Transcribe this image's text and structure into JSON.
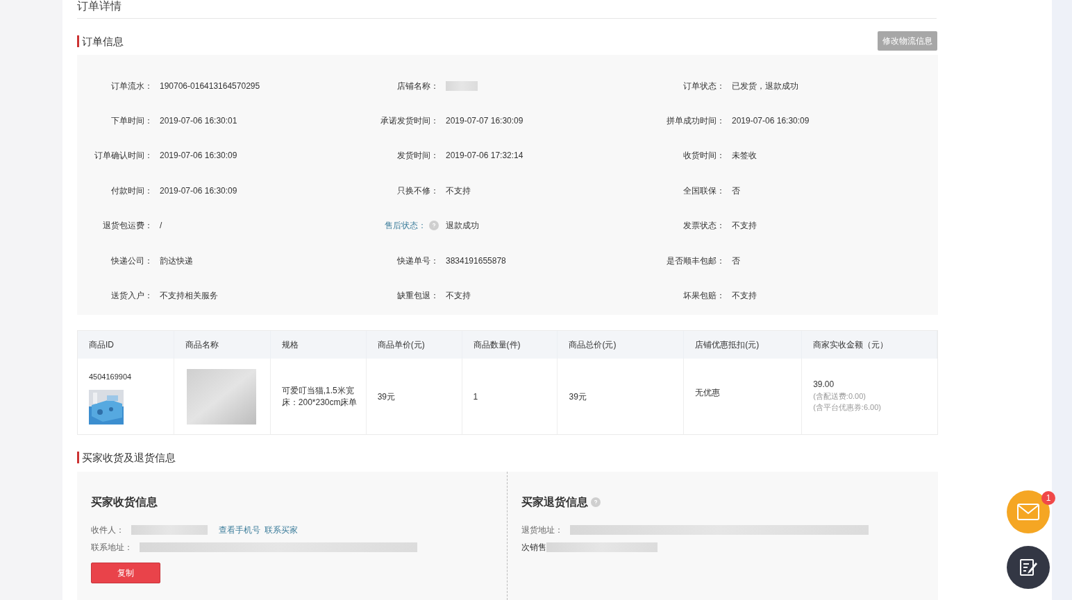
{
  "page_title": "订单详情",
  "order_info": {
    "title": "订单信息",
    "button": "修改物流信息",
    "fields": [
      {
        "kind": "text",
        "label": "订单流水：",
        "value": "190706-016413164570295"
      },
      {
        "kind": "redacted",
        "label": "店铺名称："
      },
      {
        "kind": "text",
        "label": "订单状态：",
        "value": "已发货，退款成功"
      },
      {
        "kind": "text",
        "label": "下单时间：",
        "value": "2019-07-06 16:30:01"
      },
      {
        "kind": "text",
        "label": "承诺发货时间：",
        "value": "2019-07-07 16:30:09"
      },
      {
        "kind": "text",
        "label": "拼单成功时间：",
        "value": "2019-07-06 16:30:09"
      },
      {
        "kind": "text",
        "label": "订单确认时间：",
        "value": "2019-07-06 16:30:09"
      },
      {
        "kind": "text",
        "label": "发货时间：",
        "value": "2019-07-06 17:32:14"
      },
      {
        "kind": "text",
        "label": "收货时间：",
        "value": "未签收"
      },
      {
        "kind": "text",
        "label": "付款时间：",
        "value": "2019-07-06 16:30:09"
      },
      {
        "kind": "text",
        "label": "只换不修：",
        "value": "不支持"
      },
      {
        "kind": "text",
        "label": "全国联保：",
        "value": "否"
      },
      {
        "kind": "text",
        "label": "退货包运费：",
        "value": "/"
      },
      {
        "kind": "help",
        "label": "售后状态：",
        "value": "退款成功"
      },
      {
        "kind": "text",
        "label": "发票状态：",
        "value": "不支持"
      },
      {
        "kind": "text",
        "label": "快递公司：",
        "value": "韵达快递"
      },
      {
        "kind": "text",
        "label": "快递单号：",
        "value": "3834191655878"
      },
      {
        "kind": "text",
        "label": "是否顺丰包邮：",
        "value": "否"
      },
      {
        "kind": "text",
        "label": "送货入户：",
        "value": "不支持相关服务"
      },
      {
        "kind": "text",
        "label": "缺重包退：",
        "value": "不支持"
      },
      {
        "kind": "text",
        "label": "坏果包赔：",
        "value": "不支持"
      }
    ]
  },
  "items_table": {
    "columns": [
      "商品ID",
      "商品名称",
      "规格",
      "商品单价(元)",
      "商品数量(件)",
      "商品总价(元)",
      "店铺优惠抵扣(元)",
      "商家实收金额（元）"
    ],
    "rows": [
      {
        "id": "4504169904",
        "spec": "可爱叮当猫,1.5米宽床：200*230cm床单",
        "unit_price": "39元",
        "quantity": "1",
        "total": "39元",
        "discount": "无优惠",
        "received": "39.00",
        "received_notes": [
          "(含配送费:0.00)",
          "(含平台优惠券:6.00)"
        ]
      }
    ]
  },
  "buyer_section": {
    "title": "买家收货及退货信息",
    "shipping": {
      "title": "买家收货信息",
      "recipient_label": "收件人：",
      "links": [
        "查看手机号",
        "联系买家"
      ],
      "address_label": "联系地址：",
      "copy_button": "复制"
    },
    "return": {
      "title": "买家退货信息",
      "address_label": "退货地址：",
      "note": "次销售"
    }
  },
  "floating": {
    "mail_badge": "1"
  }
}
